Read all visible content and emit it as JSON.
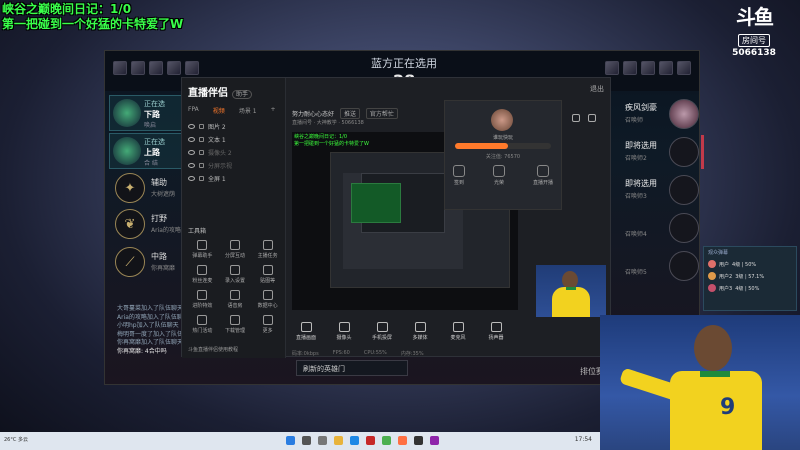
{
  "overlay": {
    "line1": "峡谷之巅晚间日记：1/0",
    "line2": "第一把碰到一个好猛的卡特爱了W"
  },
  "douyu": {
    "logo": "斗鱼",
    "room_label": "房间号",
    "room_number": "5066138"
  },
  "lol": {
    "title": "蓝方正在选用",
    "timer": "28",
    "left_slots": [
      {
        "line1": "正在选",
        "line2": "下路",
        "line3": "唤启"
      },
      {
        "line1": "正在选",
        "line2": "上路",
        "line3": "合 结"
      }
    ],
    "roles": [
      {
        "name": "辅助",
        "sub": "大树遮荫"
      },
      {
        "name": "打野",
        "sub": "Aria的攻略"
      },
      {
        "name": "中路",
        "sub": "你再窝靡"
      }
    ],
    "chat_log": [
      "大哥蔓菜加入了队伍聊天",
      "Aria的攻略加入了队伍聊天",
      "小明hp加入了队伍聊天",
      "梅明哥一度了加入了队伍",
      "你再窝靡加入了队伍聊天"
    ],
    "chat_self": "你再窝靡: 4合中吗",
    "right_slots": [
      {
        "name": "疾风剑豪",
        "status": "召唤师"
      },
      {
        "name": "即将选用",
        "status": "召唤师2"
      },
      {
        "name": "即将选用",
        "status": "召唤师3"
      },
      {
        "name": "",
        "status": "召唤师4"
      },
      {
        "name": "",
        "status": "召唤师5"
      }
    ],
    "bottom_input": "刷新的英雄门",
    "queue_label": "排位赛"
  },
  "streamer": {
    "app_name": "直播伴侣",
    "badge": "助手",
    "tabs": [
      "FPA",
      "视频",
      "场景 1"
    ],
    "layers": [
      {
        "name": "图片 2",
        "dim": false
      },
      {
        "name": "文本 1",
        "dim": false
      },
      {
        "name": "摄像头 2",
        "dim": true
      },
      {
        "name": "分屏示视",
        "dim": true
      },
      {
        "name": "全屏 1",
        "dim": false
      }
    ],
    "toolbox_title": "工具箱",
    "tools": [
      "弹幕助手",
      "分屏互动",
      "主播任务",
      "粉丝连麦",
      "录入设置",
      "贴图等",
      "进阶特效",
      "语音房",
      "数据中心",
      "热门活动",
      "下载管理",
      "更多"
    ],
    "bottom_link": "斗鱼直播伴侣使用教程",
    "header_title": "努力耐心心态好",
    "header_chips": [
      "推送",
      "官方帮忙"
    ],
    "sub_info": "直播间号 · 大神教学 · 5066138",
    "preview_overlay1": "峡谷之巅晚间日记：1/0",
    "preview_overlay2": "第一把碰到一个好猛的卡特爱了W",
    "controls": [
      "直播画面",
      "摄像头",
      "手机投屏",
      "多媒体",
      "麦克风",
      "扬声器"
    ],
    "status": [
      "码率:0kbps",
      "FPS:60",
      "CPU:55%",
      "内存:35%"
    ],
    "profile_name": "谁玩快玩",
    "profile_level": "55.5%",
    "profile_fans": "关注值: 76570",
    "profile_actions": [
      "签到",
      "光荣",
      "直播开播"
    ],
    "right_label": "退出"
  },
  "chat_widget": {
    "title": "观众弹幕",
    "rows": [
      {
        "name": "用户",
        "info": "4级 | 50%",
        "color": "#e0706a"
      },
      {
        "name": "用户2",
        "info": "3级 | 57.1%",
        "color": "#e09a4a"
      },
      {
        "name": "用户3",
        "info": "4级 | 50%",
        "color": "#c4506b"
      }
    ]
  },
  "camera": {
    "jersey_number": "9"
  },
  "taskbar": {
    "temp": "26°C 多云",
    "time": "17:54"
  }
}
